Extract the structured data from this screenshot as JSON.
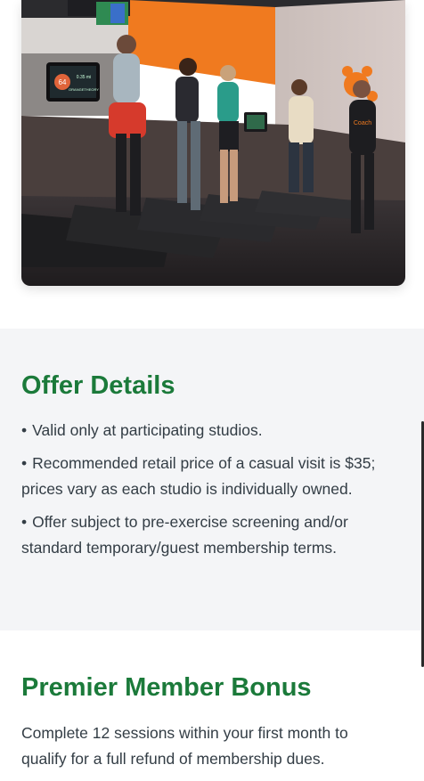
{
  "hero": {
    "treadmill_screen_text": "0.35 mi",
    "screen_brand": "ORANGETHEORY",
    "dial_value": "64",
    "coach_shirt_text": "Coach"
  },
  "offer_details": {
    "title": "Offer Details",
    "items": [
      "Valid only at participating studios.",
      "Recommended retail price of a casual visit is $35; prices vary as each studio is individually owned.",
      "Offer subject to pre-exercise screening and/or standard temporary/guest membership terms."
    ]
  },
  "premier_bonus": {
    "title": "Premier Member Bonus",
    "text": "Complete 12 sessions within your first month to qualify for a full refund of membership dues."
  },
  "colors": {
    "heading_green": "#1b7a3a",
    "body_text": "#333d45",
    "section_bg": "#f4f5f7",
    "brand_orange": "#f07a1f"
  }
}
